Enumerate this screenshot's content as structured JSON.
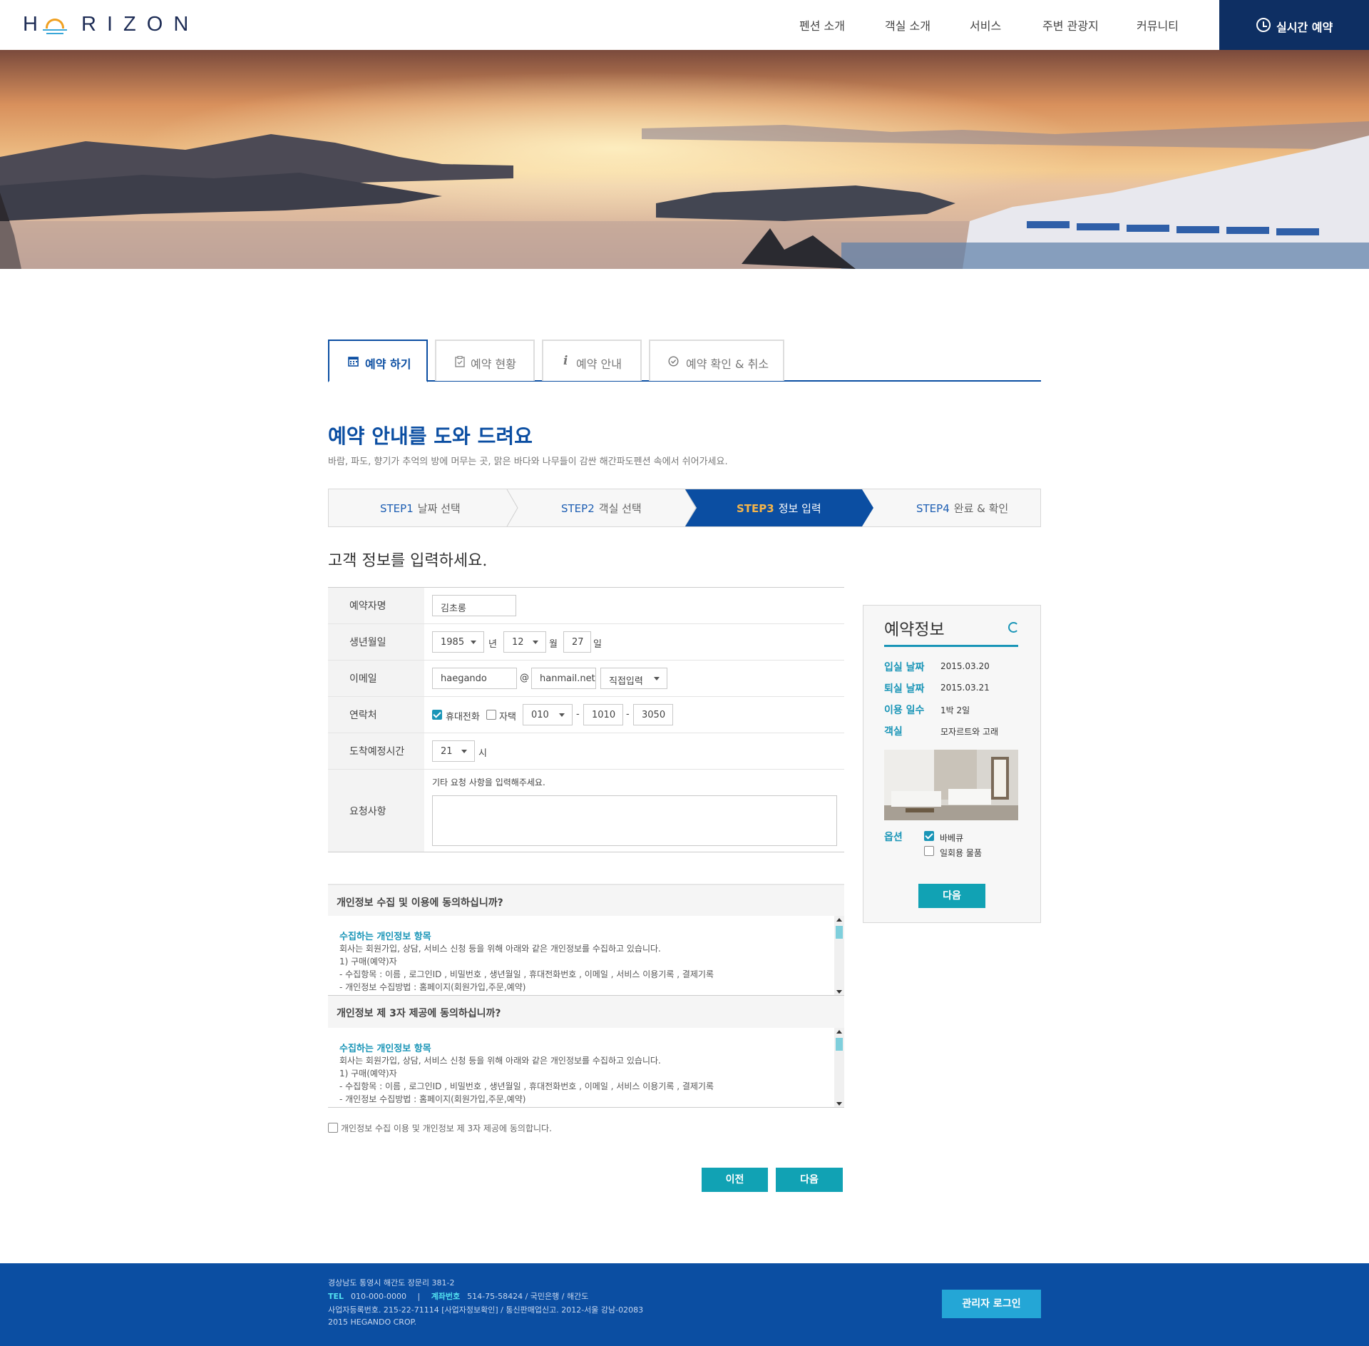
{
  "header": {
    "logo": "HORIZON",
    "nav": [
      "펜션 소개",
      "객실 소개",
      "서비스",
      "주변 관광지",
      "커뮤니티"
    ],
    "reserve_button": "실시간 예약"
  },
  "tabs": [
    {
      "label": "예약 하기",
      "icon": "calendar-icon",
      "active": true
    },
    {
      "label": "예약 현황",
      "icon": "clipboard-icon",
      "active": false
    },
    {
      "label": "예약 안내",
      "icon": "info-icon",
      "active": false
    },
    {
      "label": "예약 확인 & 취소",
      "icon": "check-circle-icon",
      "active": false
    }
  ],
  "page": {
    "title": "예약 안내를 도와 드려요",
    "description": "바람, 파도, 향기가 추억의 방에 머무는 곳, 맑은 바다와 나무들이 감싼 해간파도펜션 속에서 쉬어가세요."
  },
  "steps": [
    {
      "num": "STEP1",
      "label": "날짜 선택",
      "active": false
    },
    {
      "num": "STEP2",
      "label": "객실 선택",
      "active": false
    },
    {
      "num": "STEP3",
      "label": "정보 입력",
      "active": true
    },
    {
      "num": "STEP4",
      "label": "완료 & 확인",
      "active": false
    }
  ],
  "form": {
    "title": "고객 정보를 입력하세요.",
    "name_label": "예약자명",
    "name_value": "김초롱",
    "birth_label": "생년월일",
    "birth_year": "1985",
    "birth_year_unit": "년",
    "birth_month": "12",
    "birth_month_unit": "월",
    "birth_day": "27",
    "birth_day_unit": "일",
    "email_label": "이메일",
    "email_id": "haegando",
    "email_at": "@",
    "email_domain": "hanmail.net",
    "email_select": "직접입력",
    "contact_label": "연락처",
    "mobile_label": "휴대전화",
    "mobile_checked": true,
    "home_label": "자택",
    "home_checked": false,
    "phone1": "010",
    "phone_dash": "-",
    "phone2": "1010",
    "phone3": "3050",
    "arrival_label": "도착예정시간",
    "arrival_hour": "21",
    "arrival_unit": "시",
    "request_label": "요청사항",
    "request_hint": "기타 요청 사항을 입력해주세요."
  },
  "agreements": [
    {
      "question": "개인정보 수집 및 이용에 동의하십니까?",
      "heading": "수집하는 개인정보 항목",
      "lines": [
        "회사는 회원가입, 상담, 서비스 신청 등을 위해 아래와 같은 개인정보를 수집하고 있습니다.",
        "1) 구매(예약)자",
        "- 수집항목 : 이름 , 로그인ID , 비밀번호 , 생년월일 , 휴대전화번호 , 이메일 , 서비스 이용기록 , 결제기록",
        "- 개인정보 수집방법 : 홈페이지(회원가입,주문,예약)"
      ]
    },
    {
      "question": "개인정보 제 3자 제공에 동의하십니까?",
      "heading": "수집하는 개인정보 항목",
      "lines": [
        "회사는 회원가입, 상담, 서비스 신청 등을 위해 아래와 같은 개인정보를 수집하고 있습니다.",
        "1) 구매(예약)자",
        "- 수집항목 : 이름 , 로그인ID , 비밀번호 , 생년월일 , 휴대전화번호 , 이메일 , 서비스 이용기록 , 결제기록",
        "- 개인정보 수집방법 : 홈페이지(회원가입,주문,예약)"
      ]
    }
  ],
  "consent": {
    "label": "개인정보 수집 이용 및 개인정보 제 3자 제공에 동의합니다.",
    "checked": false
  },
  "buttons": {
    "prev": "이전",
    "next": "다음"
  },
  "sidebar": {
    "title": "예약정보",
    "checkin_label": "입실 날짜",
    "checkin_value": "2015.03.20",
    "checkout_label": "퇴실 날짜",
    "checkout_value": "2015.03.21",
    "nights_label": "이용 일수",
    "nights_value": "1박 2일",
    "room_label": "객실",
    "room_value": "모자르트와 고래",
    "options_label": "옵션",
    "options": [
      {
        "label": "바베큐",
        "checked": true
      },
      {
        "label": "일회용 물품",
        "checked": false
      }
    ],
    "next_button": "다음"
  },
  "footer": {
    "address": "경상남도 통영시 해간도 장문리 381-2",
    "tel_label": "TEL",
    "tel_value": "010-000-0000",
    "separator": "|",
    "account_label": "계좌번호",
    "account_value": "514-75-58424 / 국민은행 / 해간도",
    "business": "사업자등록번호. 215-22-71114 [사업자정보확인] / 통신판매업신고. 2012-서울 강남-02083",
    "copyright": "2015 HEGANDO CROP.",
    "admin_button": "관리자 로그인"
  },
  "colors": {
    "primary": "#0b4ea2",
    "navy": "#0e2f63",
    "teal": "#11a2b4"
  }
}
